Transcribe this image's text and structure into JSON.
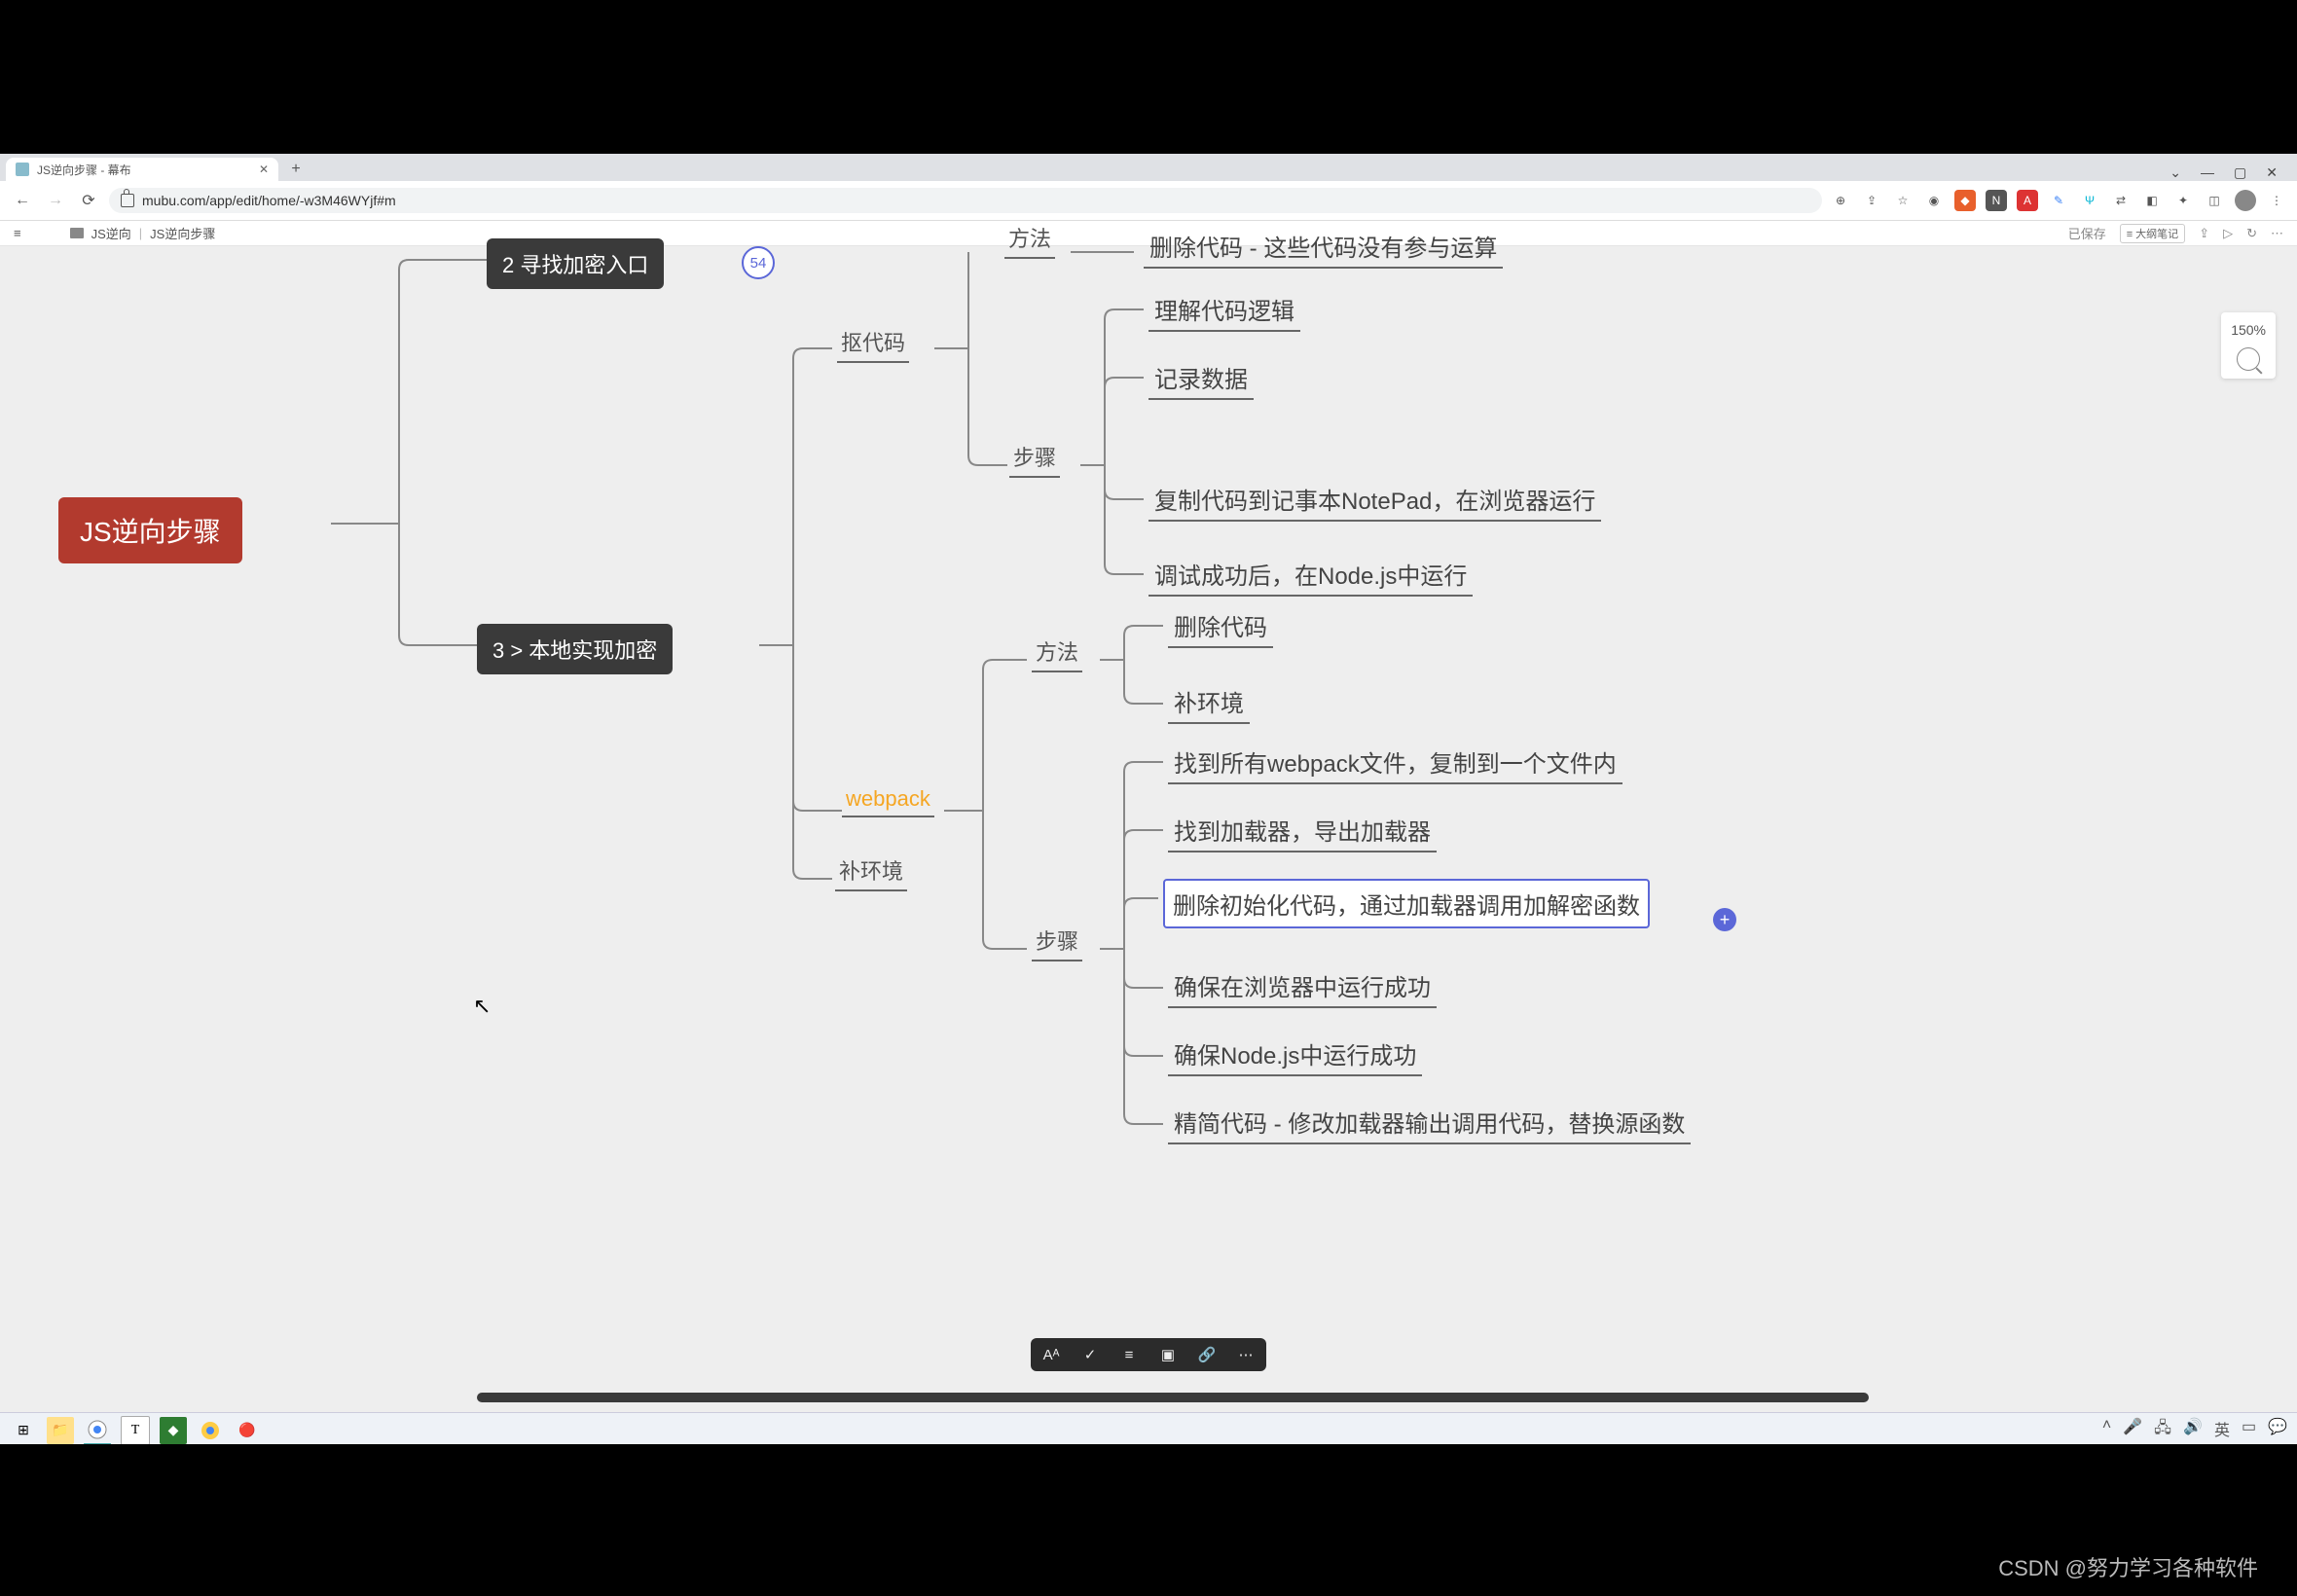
{
  "browser": {
    "tab_title": "JS逆向步骤 - 幕布",
    "url": "mubu.com/app/edit/home/-w3M46WYjf#m",
    "window_controls": {
      "min": "—",
      "max": "▢",
      "close": "✕",
      "dropdown": "⌄"
    }
  },
  "appbar": {
    "breadcrumb_folder": "JS逆向",
    "breadcrumb_doc": "JS逆向步骤",
    "saved": "已保存",
    "outline_btn": "≡ 大纲笔记"
  },
  "side": {
    "zoom": "150%"
  },
  "mindmap": {
    "root": "JS逆向步骤",
    "n2": "2 寻找加密入口",
    "n2_badge": "54",
    "n3": "3 > 本地实现加密",
    "koucode": "抠代码",
    "webpack": "webpack",
    "buhuanjing": "补环境",
    "fangfa_top": "方法",
    "buzhou_top": "步骤",
    "fangfa_wp": "方法",
    "buzhou_wp": "步骤",
    "leaf_delcode_note": "删除代码 - 这些代码没有参与运算",
    "leaf_understand": "理解代码逻辑",
    "leaf_record": "记录数据",
    "leaf_copynote": "复制代码到记事本NotePad，在浏览器运行",
    "leaf_node_after": "调试成功后，在Node.js中运行",
    "leaf_delcode": "删除代码",
    "leaf_buhuan": "补环境",
    "leaf_findwp": "找到所有webpack文件，复制到一个文件内",
    "leaf_loader": "找到加载器，导出加载器",
    "leaf_delinit": "删除初始化代码，通过加载器调用加解密函数",
    "leaf_browser_ok": "确保在浏览器中运行成功",
    "leaf_node_ok": "确保Node.js中运行成功",
    "leaf_simplify": "精简代码 - 修改加载器输出调用代码，替换源函数"
  },
  "float_toolbar": {
    "format": "Aᴬ",
    "check": "✓",
    "list": "≡",
    "image": "▣",
    "link": "🔗",
    "more": "⋯"
  },
  "watermark": "CSDN @努力学习各种软件"
}
